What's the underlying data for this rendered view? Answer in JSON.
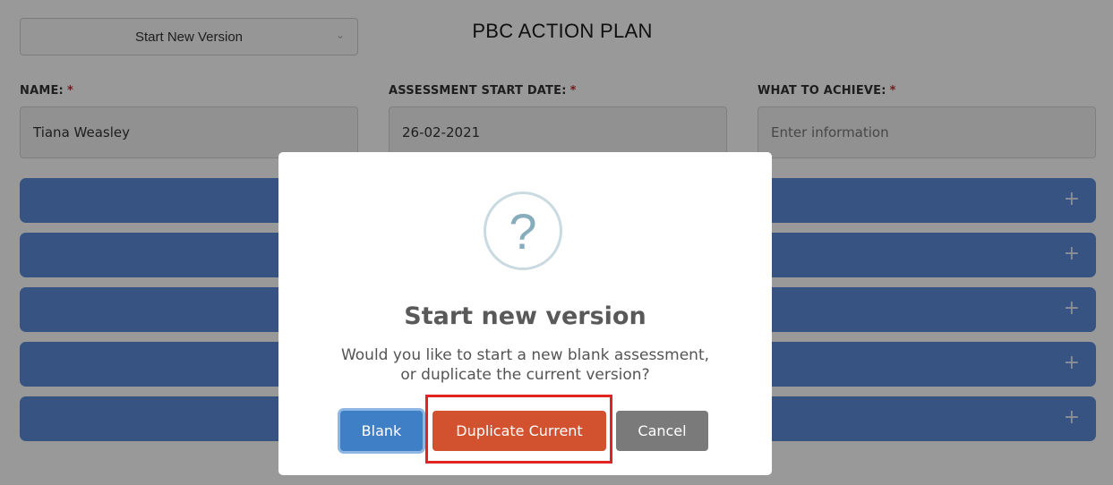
{
  "header": {
    "version_select": "Start New Version",
    "title": "PBC ACTION PLAN"
  },
  "fields": [
    {
      "label": "NAME:",
      "required_mark": "*",
      "value": "Tiana Weasley",
      "placeholder": ""
    },
    {
      "label": "ASSESSMENT START DATE:",
      "required_mark": "*",
      "value": "26-02-2021",
      "placeholder": ""
    },
    {
      "label": "WHAT TO ACHIEVE:",
      "required_mark": "*",
      "value": "",
      "placeholder": "Enter information"
    }
  ],
  "panels": {
    "expand_glyph": "+"
  },
  "modal": {
    "icon_glyph": "?",
    "title": "Start new version",
    "text_line1": "Would you like to start a new blank assessment,",
    "text_line2": "or duplicate the current version?",
    "buttons": {
      "blank": "Blank",
      "duplicate": "Duplicate Current",
      "cancel": "Cancel"
    }
  },
  "icons": {
    "select_chevron": "chevron-down-icon",
    "modal_icon": "question-icon",
    "panel_expand": "plus-icon"
  },
  "colors": {
    "panel_bar": "#5a8ad7",
    "blank_button": "#3f7fc6",
    "duplicate_button": "#d2512f",
    "cancel_button": "#7a7a7a",
    "required_mark": "#c0302f",
    "highlight": "#e0241f"
  }
}
